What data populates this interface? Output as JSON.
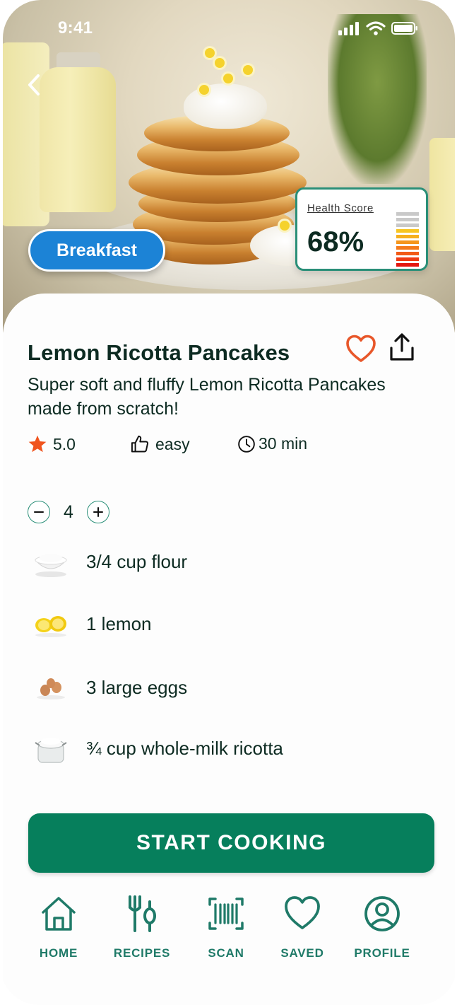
{
  "status_bar": {
    "time": "9:41"
  },
  "hero": {
    "category": "Breakfast",
    "health_score": {
      "label": "Health Score",
      "value": "68%",
      "fraction": 0.68
    }
  },
  "recipe": {
    "title": "Lemon Ricotta Pancakes",
    "description": "Super soft and fluffy Lemon Ricotta Pancakes made from scratch!",
    "rating": "5.0",
    "difficulty": "easy",
    "duration": "30 min",
    "servings": "4"
  },
  "ingredients": [
    {
      "text": "3/4 cup flour",
      "icon": "flour-bowl-icon"
    },
    {
      "text": "1 lemon",
      "icon": "lemon-icon"
    },
    {
      "text": "3 large eggs",
      "icon": "eggs-icon"
    },
    {
      "text": "¾ cup whole-milk ricotta",
      "icon": "ricotta-jar-icon"
    }
  ],
  "cta": {
    "label": "START COOKING"
  },
  "tabbar": {
    "items": [
      {
        "label": "HOME",
        "icon": "home-icon"
      },
      {
        "label": "RECIPES",
        "icon": "fork-spoon-icon"
      },
      {
        "label": "SCAN",
        "icon": "barcode-scan-icon"
      },
      {
        "label": "SAVED",
        "icon": "heart-icon"
      },
      {
        "label": "PROFILE",
        "icon": "user-circle-icon"
      }
    ]
  },
  "colors": {
    "primary": "#067f5c",
    "category_pill": "#1c83d6",
    "favorite": "#e8572a",
    "tab_label": "#1f7a68",
    "health_border": "#2a8f78"
  }
}
